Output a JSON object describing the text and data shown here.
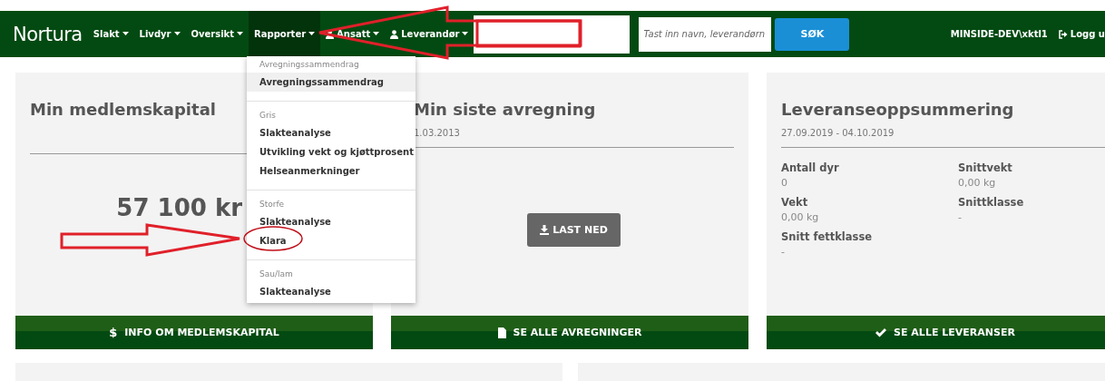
{
  "navbar": {
    "logo": "Nortura",
    "menus": [
      {
        "label": "Slakt",
        "kind": "plain",
        "selected": false
      },
      {
        "label": "Livdyr",
        "kind": "plain",
        "selected": false
      },
      {
        "label": "Oversikt",
        "kind": "plain",
        "selected": false
      },
      {
        "label": "Rapporter",
        "kind": "plain",
        "selected": true
      },
      {
        "label": "Ansatt",
        "kind": "person",
        "selected": false
      },
      {
        "label": "Leverandør",
        "kind": "person",
        "selected": false
      }
    ],
    "search": {
      "placeholder": "Tast inn navn, leverandørn",
      "button": "SØK"
    },
    "user": "MINSIDE-DEV\\xktl1",
    "logout": "Logg u"
  },
  "dropdown": {
    "sections": [
      {
        "heading": "Avregningssammendrag",
        "items": [
          {
            "label": "Avregningssammendrag",
            "selected": true
          }
        ]
      },
      {
        "heading": "Gris",
        "items": [
          {
            "label": "Slakteanalyse",
            "selected": false
          },
          {
            "label": "Utvikling vekt og kjøttprosent",
            "selected": false
          },
          {
            "label": "Helseanmerkninger",
            "selected": false
          }
        ]
      },
      {
        "heading": "Storfe",
        "items": [
          {
            "label": "Slakteanalyse",
            "selected": false
          },
          {
            "label": "Klara",
            "selected": false
          }
        ]
      },
      {
        "heading": "Sau/lam",
        "items": [
          {
            "label": "Slakteanalyse",
            "selected": false
          }
        ]
      }
    ]
  },
  "cards": [
    {
      "kind": "amount",
      "title": "Min medlemskapital",
      "amount": "57 100 kr",
      "button": {
        "symbol": "$",
        "label": "INFO OM MEDLEMSKAPITAL"
      }
    },
    {
      "kind": "download",
      "title": "Min siste avregning",
      "date": "1.03.2013",
      "download": "LAST NED",
      "button": {
        "label": "SE ALLE AVREGNINGER"
      }
    },
    {
      "kind": "stats",
      "title": "Leveranseoppsummering",
      "date": "27.09.2019 - 04.10.2019",
      "stats": [
        {
          "label": "Antall dyr",
          "value": "0"
        },
        {
          "label": "Snittvekt",
          "value": "0,00 kg"
        },
        {
          "label": "Vekt",
          "value": "0,00 kg"
        },
        {
          "label": "Snittklasse",
          "value": "-"
        },
        {
          "label": "Snitt fettklasse",
          "value": "-"
        }
      ],
      "button": {
        "label": "SE ALLE LEVERANSER"
      }
    }
  ]
}
